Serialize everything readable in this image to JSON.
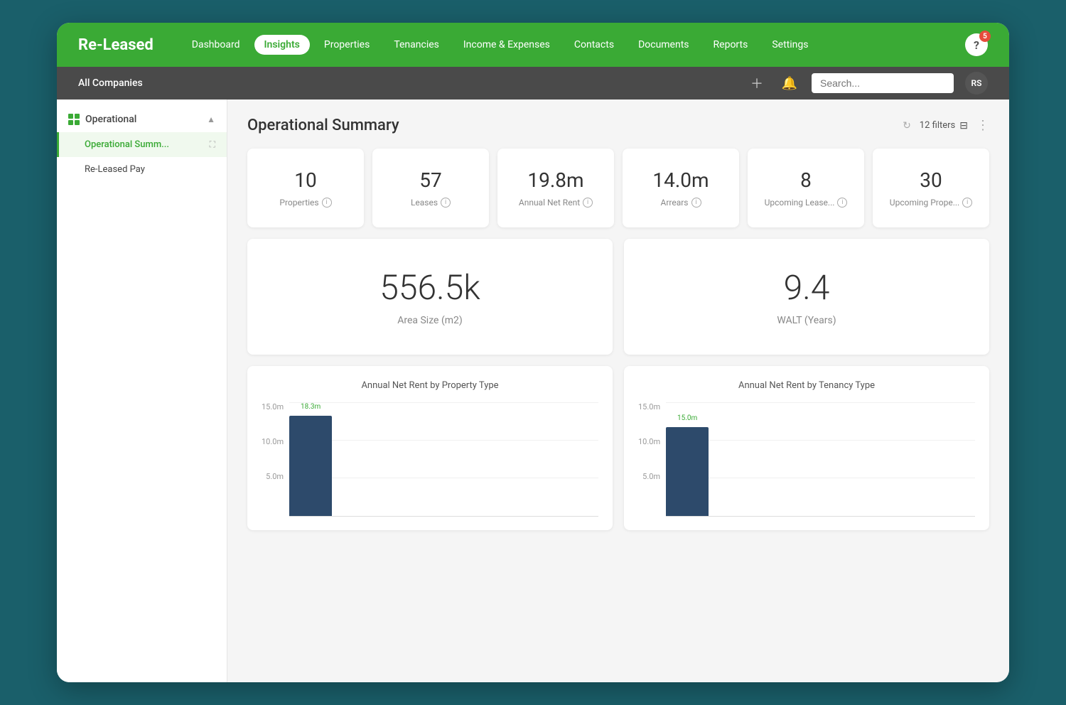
{
  "app": {
    "logo": "Re-Leased",
    "nav": {
      "items": [
        {
          "label": "Dashboard",
          "active": false
        },
        {
          "label": "Insights",
          "active": true
        },
        {
          "label": "Properties",
          "active": false
        },
        {
          "label": "Tenancies",
          "active": false
        },
        {
          "label": "Income & Expenses",
          "active": false
        },
        {
          "label": "Contacts",
          "active": false
        },
        {
          "label": "Documents",
          "active": false
        },
        {
          "label": "Reports",
          "active": false
        },
        {
          "label": "Settings",
          "active": false
        }
      ],
      "help_badge": "5",
      "help_label": "?"
    }
  },
  "subnav": {
    "company": "All Companies",
    "search_placeholder": "Search...",
    "avatar": "RS"
  },
  "sidebar": {
    "section_label": "Operational",
    "items": [
      {
        "label": "Operational Summ...",
        "active": true
      },
      {
        "label": "Re-Leased Pay",
        "active": false
      }
    ]
  },
  "content": {
    "title": "Operational Summary",
    "filters_count": "12 filters",
    "stats": [
      {
        "value": "10",
        "label": "Properties"
      },
      {
        "value": "57",
        "label": "Leases"
      },
      {
        "value": "19.8m",
        "label": "Annual Net Rent"
      },
      {
        "value": "14.0m",
        "label": "Arrears"
      },
      {
        "value": "8",
        "label": "Upcoming Lease..."
      },
      {
        "value": "30",
        "label": "Upcoming Prope..."
      }
    ],
    "big_stats": [
      {
        "value": "556.5k",
        "label": "Area Size (m2)"
      },
      {
        "value": "9.4",
        "label": "WALT (Years)"
      }
    ],
    "charts": [
      {
        "title": "Annual Net Rent by Property Type",
        "bar_label": "18.3m",
        "y_labels": [
          "15.0m",
          "10.0m",
          "5.0m"
        ],
        "bar_height_pct": 88
      },
      {
        "title": "Annual Net Rent by Tenancy Type",
        "bar_label": "15.0m",
        "y_labels": [
          "15.0m",
          "10.0m",
          "5.0m"
        ],
        "bar_height_pct": 78
      }
    ]
  }
}
